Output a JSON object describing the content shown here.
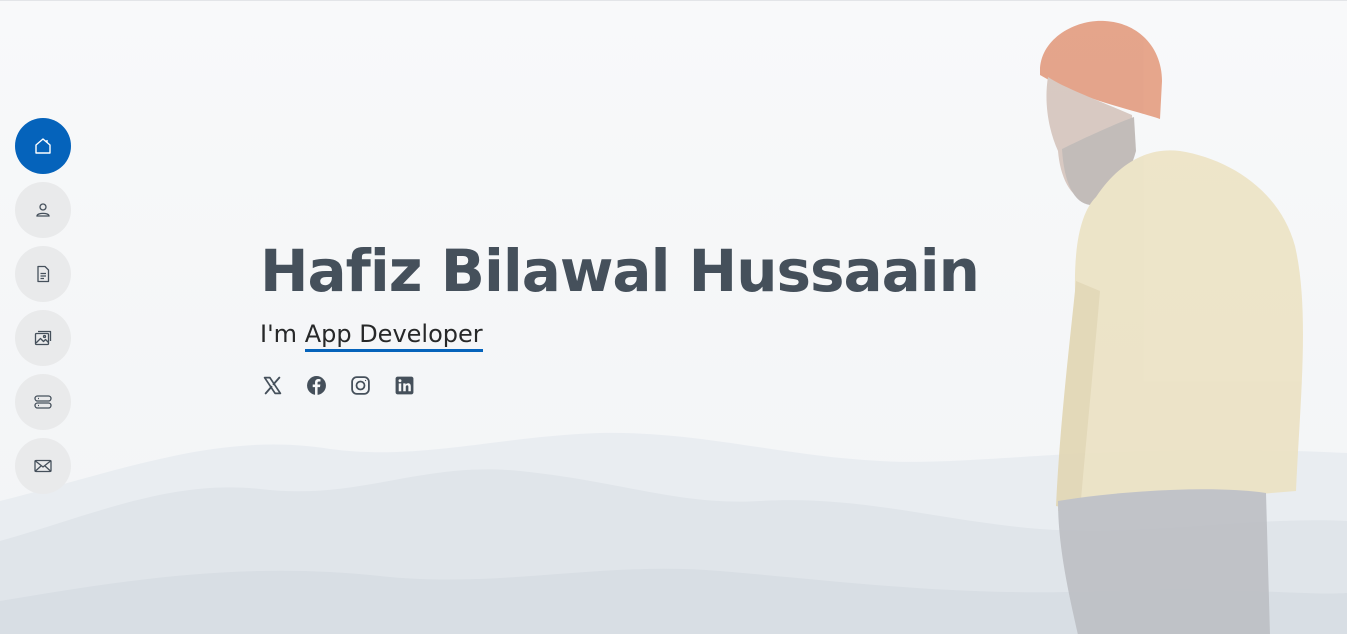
{
  "hero": {
    "name": "Hafiz Bilawal Hussaain",
    "prefix": "I'm ",
    "typed_text": "App Developer"
  },
  "nav": {
    "items": [
      {
        "icon": "home-icon",
        "active": true
      },
      {
        "icon": "person-icon",
        "active": false
      },
      {
        "icon": "file-text-icon",
        "active": false
      },
      {
        "icon": "images-icon",
        "active": false
      },
      {
        "icon": "server-icon",
        "active": false
      },
      {
        "icon": "envelope-icon",
        "active": false
      }
    ]
  },
  "social": [
    {
      "icon": "x-twitter-icon"
    },
    {
      "icon": "facebook-icon"
    },
    {
      "icon": "instagram-icon"
    },
    {
      "icon": "linkedin-icon"
    }
  ],
  "colors": {
    "accent": "#0563bb",
    "heading": "#45505b",
    "text": "#272829",
    "nav_bg": "#e9eaeb",
    "icon": "#45505b"
  }
}
